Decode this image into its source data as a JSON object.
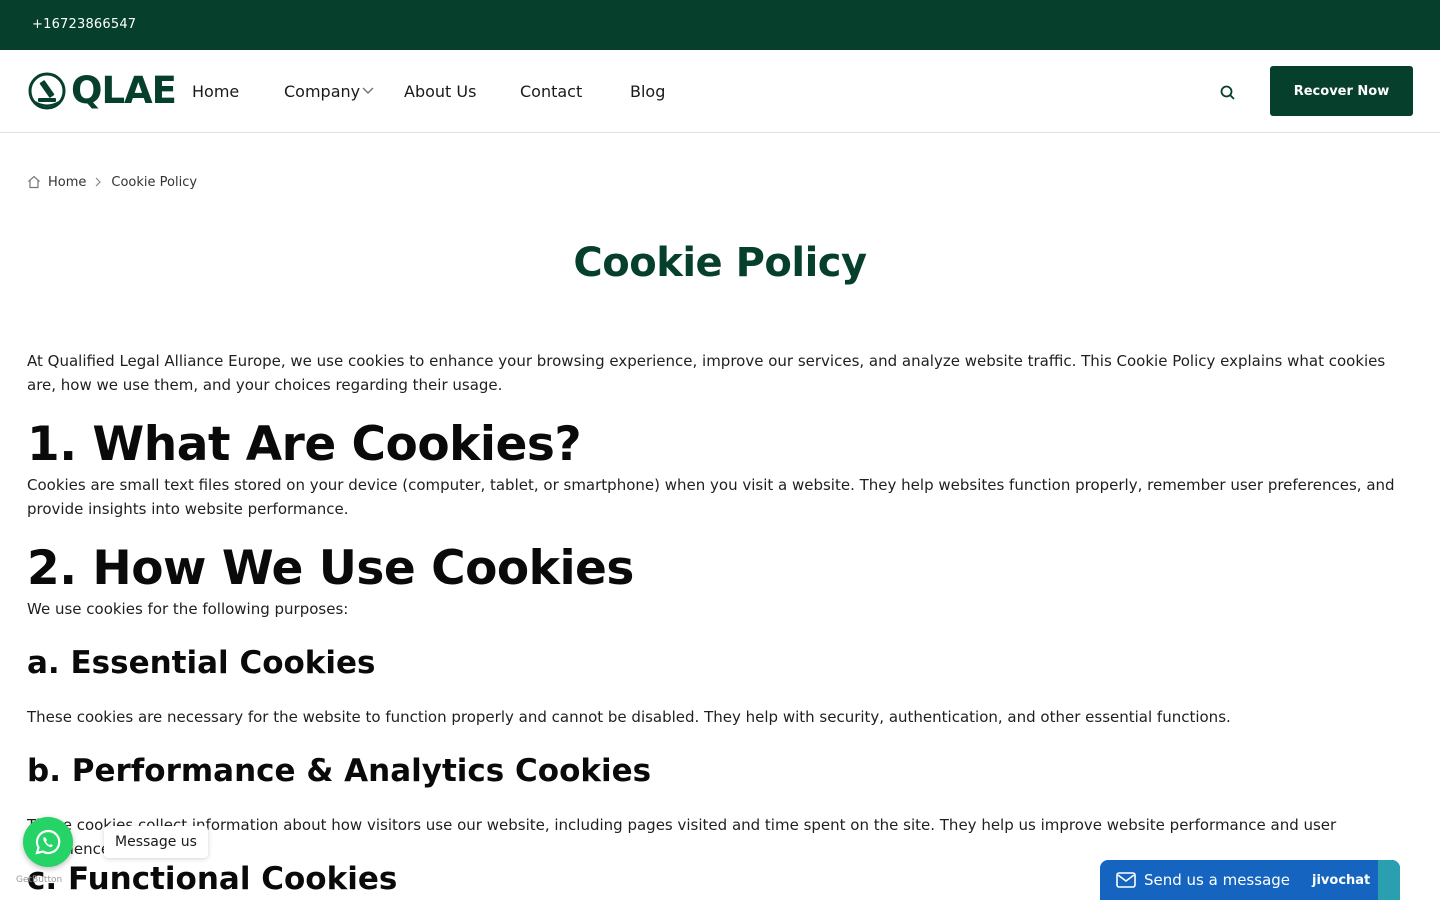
{
  "topbar": {
    "phone": "+16723866547"
  },
  "brand": {
    "logo_text": "QLAE"
  },
  "nav": {
    "items": [
      {
        "label": "Home"
      },
      {
        "label": "Company"
      },
      {
        "label": "About Us"
      },
      {
        "label": "Contact"
      },
      {
        "label": "Blog"
      }
    ],
    "cta_label": "Recover Now"
  },
  "breadcrumb": {
    "home": "Home",
    "current": "Cookie Policy"
  },
  "page": {
    "title": "Cookie Policy",
    "intro": "At Qualified Legal Alliance Europe, we use cookies to enhance your browsing experience, improve our services, and analyze website traffic. This Cookie Policy explains what cookies are, how we use them, and your choices regarding their usage.",
    "s1_heading": "1. What Are Cookies?",
    "s1_text": "Cookies are small text files stored on your device (computer, tablet, or smartphone) when you visit a website. They help websites function properly, remember user preferences, and provide insights into website performance.",
    "s2_heading": "2. How We Use Cookies",
    "s2_text": "We use cookies for the following purposes:",
    "a_heading": "a. Essential Cookies",
    "a_text": "These cookies are necessary for the website to function properly and cannot be disabled. They help with security, authentication, and other essential functions.",
    "b_heading": "b. Performance & Analytics Cookies",
    "b_text": "These cookies collect information about how visitors use our website, including pages visited and time spent on the site. They help us improve website performance and user experience.",
    "c_heading": "c. Functional Cookies"
  },
  "widgets": {
    "whatsapp_label": "Message us",
    "getbutton": "GetButton",
    "jivo_text": "Send us a message",
    "jivo_brand": "jivochat"
  },
  "colors": {
    "brand_green": "#063f2c",
    "whatsapp_green": "#25d366",
    "jivo_blue": "#1565c0"
  }
}
